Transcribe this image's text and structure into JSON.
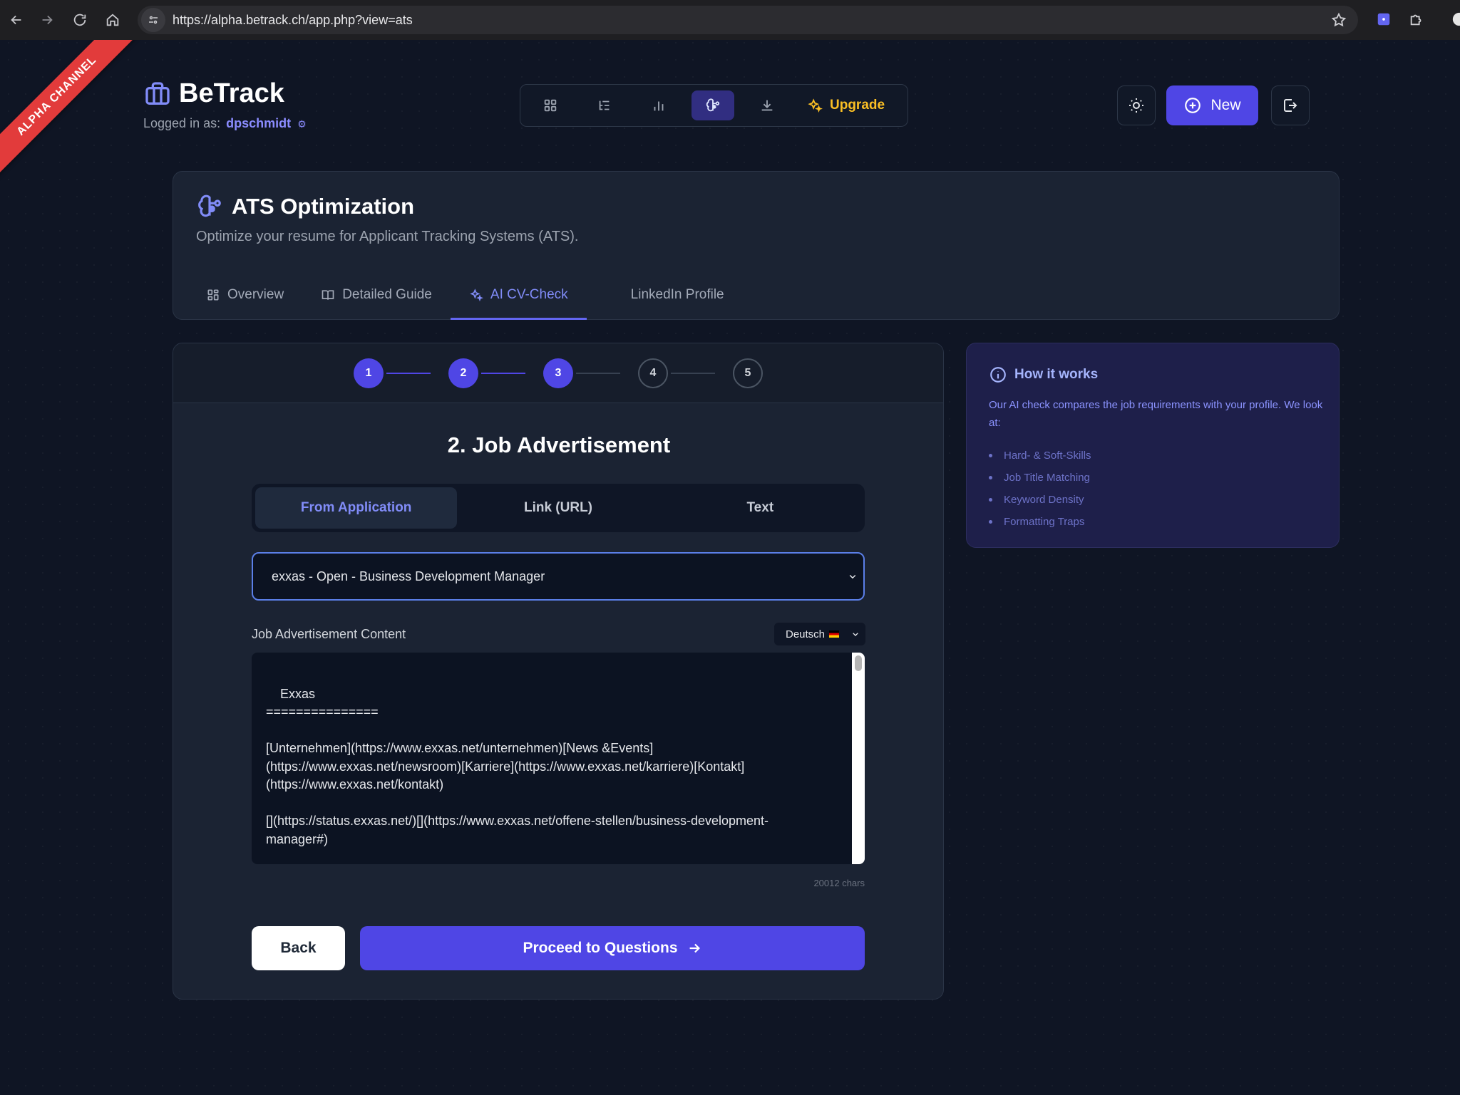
{
  "browser": {
    "url": "https://alpha.betrack.ch/app.php?view=ats"
  },
  "ribbon": {
    "label": "ALPHA CHANNEL"
  },
  "header": {
    "brand": "BeTrack",
    "logged_in_label": "Logged in as:",
    "username": "dpschmidt",
    "upgrade_label": "Upgrade",
    "new_label": "New"
  },
  "ats": {
    "title": "ATS Optimization",
    "subtitle": "Optimize your resume for Applicant Tracking Systems (ATS).",
    "tabs": [
      {
        "label": "Overview",
        "icon": "grid-icon"
      },
      {
        "label": "Detailed Guide",
        "icon": "book-icon"
      },
      {
        "label": "AI CV-Check",
        "icon": "sparkles-icon",
        "active": true
      },
      {
        "label": "LinkedIn Profile"
      }
    ]
  },
  "wizard": {
    "steps": [
      "1",
      "2",
      "3",
      "4",
      "5"
    ],
    "completed_steps": 3,
    "title": "2. Job Advertisement",
    "source_options": [
      "From Application",
      "Link (URL)",
      "Text"
    ],
    "selected_source": "From Application",
    "selected_application": "exxas - Open - Business Development Manager",
    "content_label": "Job Advertisement Content",
    "language": "Deutsch",
    "content": "Exxas\n===============\n\n[Unternehmen](https://www.exxas.net/unternehmen)[News &Events](https://www.exxas.net/newsroom)[Karriere](https://www.exxas.net/karriere)[Kontakt](https://www.exxas.net/kontakt)\n\n[](https://status.exxas.net/)[](https://www.exxas.net/offene-stellen/business-development-manager#)\n\nWähle dein Land",
    "char_count": "20012 chars",
    "back_label": "Back",
    "proceed_label": "Proceed to Questions"
  },
  "how_it_works": {
    "title": "How it works",
    "description": "Our AI check compares the job requirements with your profile. We look at:",
    "items": [
      "Hard- & Soft-Skills",
      "Job Title Matching",
      "Keyword Density",
      "Formatting Traps"
    ]
  },
  "colors": {
    "accent": "#4f46e5",
    "accent_text": "#818cf8",
    "upgrade": "#fbbf24",
    "ribbon": "#e23b3b",
    "background": "#0f1524",
    "card": "#1b2333"
  }
}
